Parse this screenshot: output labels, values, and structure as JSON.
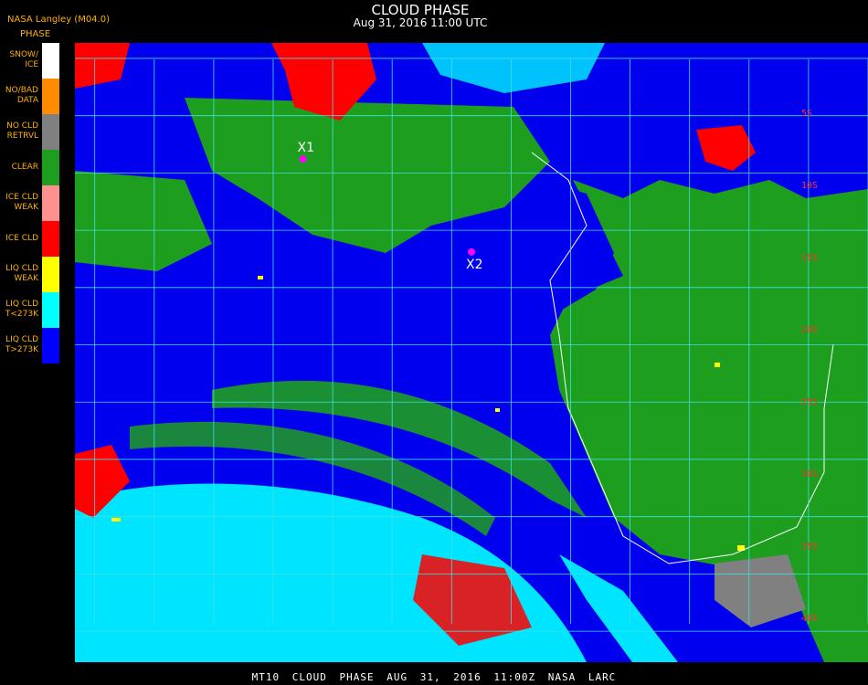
{
  "header": {
    "title": "CLOUD PHASE",
    "subtitle": "Aug 31, 2016 11:00 UTC"
  },
  "org": "NASA Langley (M04.0)",
  "legend": {
    "heading": "PHASE",
    "items": [
      {
        "label": "SNOW/\nICE",
        "color": "#ffffff"
      },
      {
        "label": "NO/BAD\nDATA",
        "color": "#ff8c00"
      },
      {
        "label": "NO CLD\nRETRVL",
        "color": "#808080"
      },
      {
        "label": "CLEAR",
        "color": "#1e9e1e"
      },
      {
        "label": "ICE CLD\nWEAK",
        "color": "#ff9090"
      },
      {
        "label": "ICE CLD",
        "color": "#ff0000"
      },
      {
        "label": "LIQ CLD\nWEAK",
        "color": "#ffff00"
      },
      {
        "label": "LIQ CLD\nT<273K",
        "color": "#00ffff"
      },
      {
        "label": "LIQ CLD\nT>273K",
        "color": "#0000ff"
      }
    ]
  },
  "markers": [
    {
      "label": "X1",
      "lat": -8.5,
      "lon": -18.5
    },
    {
      "label": "X2",
      "lat": -14.5,
      "lon": -10.0
    }
  ],
  "grid_labels": [
    "5S",
    "10S",
    "15S",
    "20S",
    "25S",
    "30S",
    "35S",
    "40S"
  ],
  "footer": "MT10 CLOUD PHASE AUG 31, 2016 11:00Z NASA LARC"
}
